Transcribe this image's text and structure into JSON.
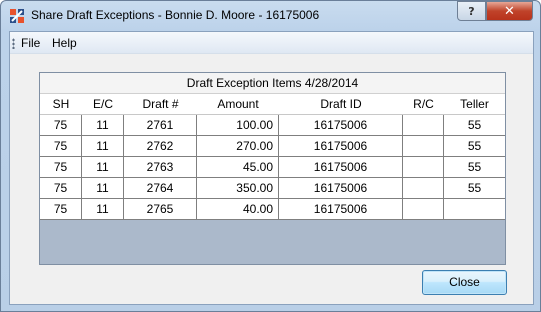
{
  "window": {
    "title": "Share Draft Exceptions - Bonnie D. Moore - 16175006",
    "help_caption": "?",
    "close_caption": "✕"
  },
  "menu": {
    "file_label": "File",
    "help_label": "Help"
  },
  "grid": {
    "caption": "Draft Exception Items 4/28/2014",
    "columns": [
      "SH",
      "E/C",
      "Draft #",
      "Amount",
      "Draft ID",
      "R/C",
      "Teller"
    ],
    "rows": [
      {
        "sh": "75",
        "ec": "11",
        "draft": "2761",
        "amount": "100.00",
        "draft_id": "16175006",
        "rc": "",
        "teller": "55"
      },
      {
        "sh": "75",
        "ec": "11",
        "draft": "2762",
        "amount": "270.00",
        "draft_id": "16175006",
        "rc": "",
        "teller": "55"
      },
      {
        "sh": "75",
        "ec": "11",
        "draft": "2763",
        "amount": "45.00",
        "draft_id": "16175006",
        "rc": "",
        "teller": "55"
      },
      {
        "sh": "75",
        "ec": "11",
        "draft": "2764",
        "amount": "350.00",
        "draft_id": "16175006",
        "rc": "",
        "teller": "55"
      },
      {
        "sh": "75",
        "ec": "11",
        "draft": "2765",
        "amount": "40.00",
        "draft_id": "16175006",
        "rc": "",
        "teller": ""
      }
    ]
  },
  "footer": {
    "close_label": "Close"
  },
  "icons": {
    "app": "app-icon",
    "help": "help-icon",
    "close": "close-icon",
    "grip": "grip-icon"
  },
  "colors": {
    "grid_background": "#abb9cb",
    "close_button_accent": "#3c7fb1",
    "window_close": "#c0432a"
  }
}
